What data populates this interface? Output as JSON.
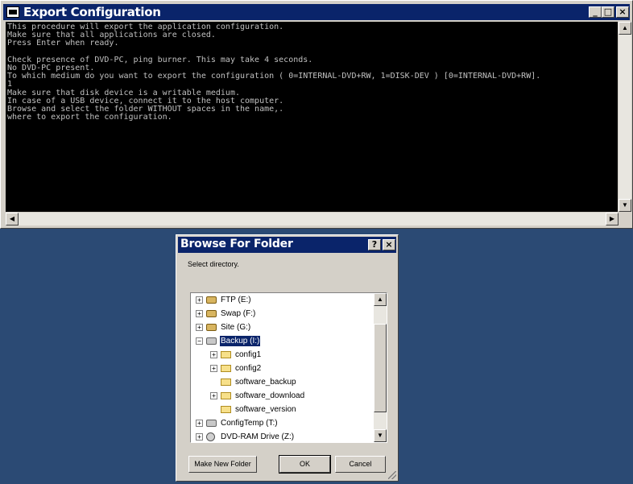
{
  "console": {
    "title": "Export Configuration",
    "lines": [
      "This procedure will export the application configuration.",
      "Make sure that all applications are closed.",
      "Press Enter when ready.",
      "",
      "Check presence of DVD-PC, ping burner. This may take 4 seconds.",
      "No DVD-PC present.",
      "To which medium do you want to export the configuration ( 0=INTERNAL-DVD+RW, 1=DISK-DEV ) [0=INTERNAL-DVD+RW].",
      "1",
      "Make sure that disk device is a writable medium.",
      "In case of a USB device, connect it to the host computer.",
      "Browse and select the folder WITHOUT spaces in the name,.",
      "where to export the configuration."
    ],
    "minimize_label": "_",
    "maximize_label": "□",
    "close_label": "×"
  },
  "dialog": {
    "title": "Browse For Folder",
    "help_label": "?",
    "close_label": "×",
    "instruction": "Select directory.",
    "tree": [
      {
        "label": "FTP (E:)",
        "icon": "network-drive-icon",
        "expander": "+",
        "level": 0,
        "selected": false
      },
      {
        "label": "Swap (F:)",
        "icon": "network-drive-icon",
        "expander": "+",
        "level": 0,
        "selected": false
      },
      {
        "label": "Site (G:)",
        "icon": "network-drive-icon",
        "expander": "+",
        "level": 0,
        "selected": false
      },
      {
        "label": "Backup (I:)",
        "icon": "drive-icon",
        "expander": "−",
        "level": 0,
        "selected": true
      },
      {
        "label": "config1",
        "icon": "folder-icon",
        "expander": "+",
        "level": 1,
        "selected": false
      },
      {
        "label": "config2",
        "icon": "folder-icon",
        "expander": "+",
        "level": 1,
        "selected": false
      },
      {
        "label": "software_backup",
        "icon": "folder-icon",
        "expander": "",
        "level": 1,
        "selected": false
      },
      {
        "label": "software_download",
        "icon": "folder-icon",
        "expander": "+",
        "level": 1,
        "selected": false
      },
      {
        "label": "software_version",
        "icon": "folder-icon",
        "expander": "",
        "level": 1,
        "selected": false
      },
      {
        "label": "ConfigTemp (T:)",
        "icon": "drive-icon",
        "expander": "+",
        "level": 0,
        "selected": false
      },
      {
        "label": "DVD-RAM Drive (Z:)",
        "icon": "dvd-drive-icon",
        "expander": "+",
        "level": 0,
        "selected": false
      }
    ],
    "buttons": {
      "new_folder": "Make New Folder",
      "ok": "OK",
      "cancel": "Cancel"
    }
  }
}
